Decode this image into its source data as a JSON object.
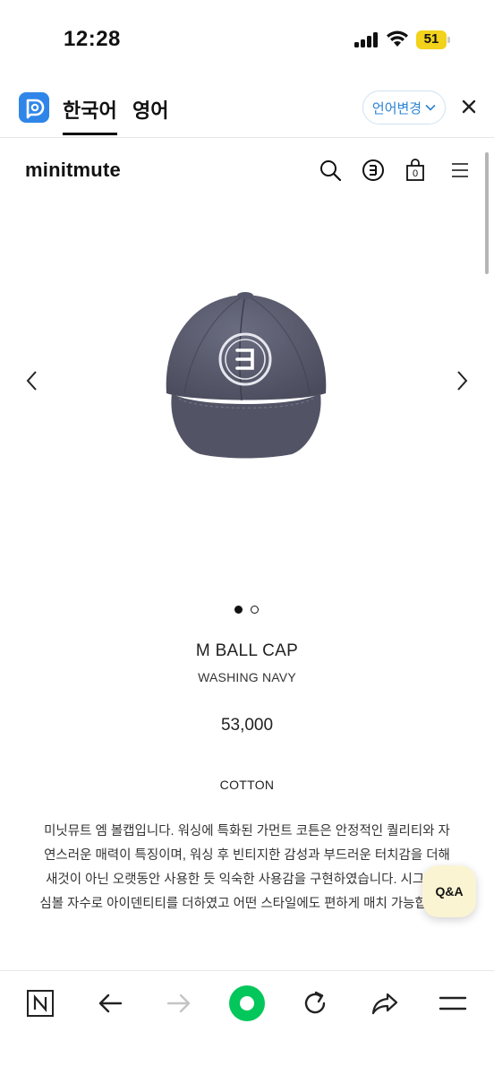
{
  "status_bar": {
    "time": "12:28",
    "battery_level": "51",
    "battery_color": "#f2d21a"
  },
  "translate_bar": {
    "logo_icon": "papago-icon",
    "active_language": "한국어",
    "other_language": "영어",
    "change_language_label": "언어변경",
    "accent_color": "#2b84d6"
  },
  "site_header": {
    "brand": "minitmute",
    "icons": [
      "search-icon",
      "brand-e-icon",
      "shopping-bag-icon",
      "hamburger-menu-icon"
    ],
    "cart_count": "0"
  },
  "product": {
    "image_icon": "navy-ball-cap-image",
    "carousel": {
      "current": 1,
      "total": 2
    },
    "name": "M BALL CAP",
    "color": "WASHING NAVY",
    "price": "53,000",
    "material": "COTTON",
    "description": "미닛뮤트 엠 볼캡입니다. 워싱에 특화된 가먼트 코튼은 안정적인 퀄리티와 자연스러운 매력이 특징이며, 워싱 후 빈티지한 감성과 부드러운 터치감을 더해 새것이 아닌 오랫동안 사용한 듯 익숙한 사용감을 구현하였습니다. 시그니처 심볼 자수로 아이덴티티를 더하였고 어떤 스타일에도 편하게 매치 가능합니다."
  },
  "qa_button": {
    "label": "Q&A"
  },
  "bottom_toolbar": {
    "buttons": [
      "naver-n-icon",
      "back-arrow-icon",
      "forward-arrow-icon",
      "home-circle-icon",
      "refresh-icon",
      "share-icon",
      "menu-icon"
    ],
    "accent_color": "#03c75a"
  }
}
